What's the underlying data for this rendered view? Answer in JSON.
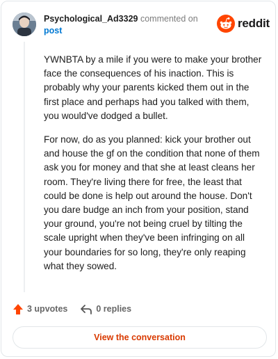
{
  "comment": {
    "username": "Psychological_Ad3329",
    "action_text": "commented on",
    "target_link": "post",
    "paragraphs": [
      "YWNBTA by a mile if you were to make your brother face the consequences of his inaction. This is probably why your parents kicked them out in the first place and perhaps had you talked with them, you would've dodged a bullet.",
      "For now, do as you planned: kick your brother out and house the gf on the condition that none of them ask you for money and that she at least cleans her room. They're living there for free, the least that could be done is help out around the house. Don't you dare budge an inch from your position, stand your ground, you're not being cruel by tilting the scale upright when they've been infringing on all your boundaries for so long, they're only reaping what they sowed."
    ],
    "upvotes_label": "3 upvotes",
    "replies_label": "0 replies"
  },
  "brand": {
    "wordmark": "reddit",
    "color": "#ff4500"
  },
  "cta": {
    "label": "View the conversation",
    "color": "#d93a00"
  },
  "icons": {
    "upvote": "upvote-arrow-icon",
    "reply": "reply-arrow-icon",
    "logo": "reddit-snoo-icon"
  }
}
